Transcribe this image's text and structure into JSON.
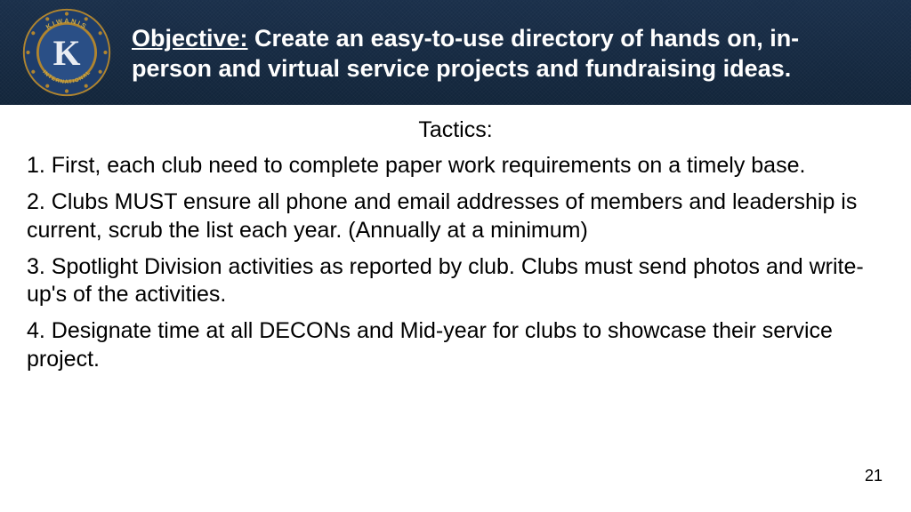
{
  "header": {
    "objective_label": "Objective:",
    "objective_text": " Create an easy-to-use directory of hands on, in-person and virtual service projects and fundraising ideas.",
    "logo": {
      "org_top": "KIWANIS",
      "org_bottom": "INTERNATIONAL",
      "letter": "K"
    }
  },
  "content": {
    "tactics_heading": "Tactics:",
    "tactics": [
      "1. First, each club need to complete paper work requirements on a timely base.",
      "2. Clubs MUST ensure all phone and email addresses of members and leadership is current, scrub the list each year. (Annually at a minimum)",
      "3. Spotlight Division activities as reported by club. Clubs must send photos and write-up's of the activities.",
      "4. Designate time at all DECONs and Mid-year for clubs to showcase their service project."
    ]
  },
  "page_number": "21"
}
